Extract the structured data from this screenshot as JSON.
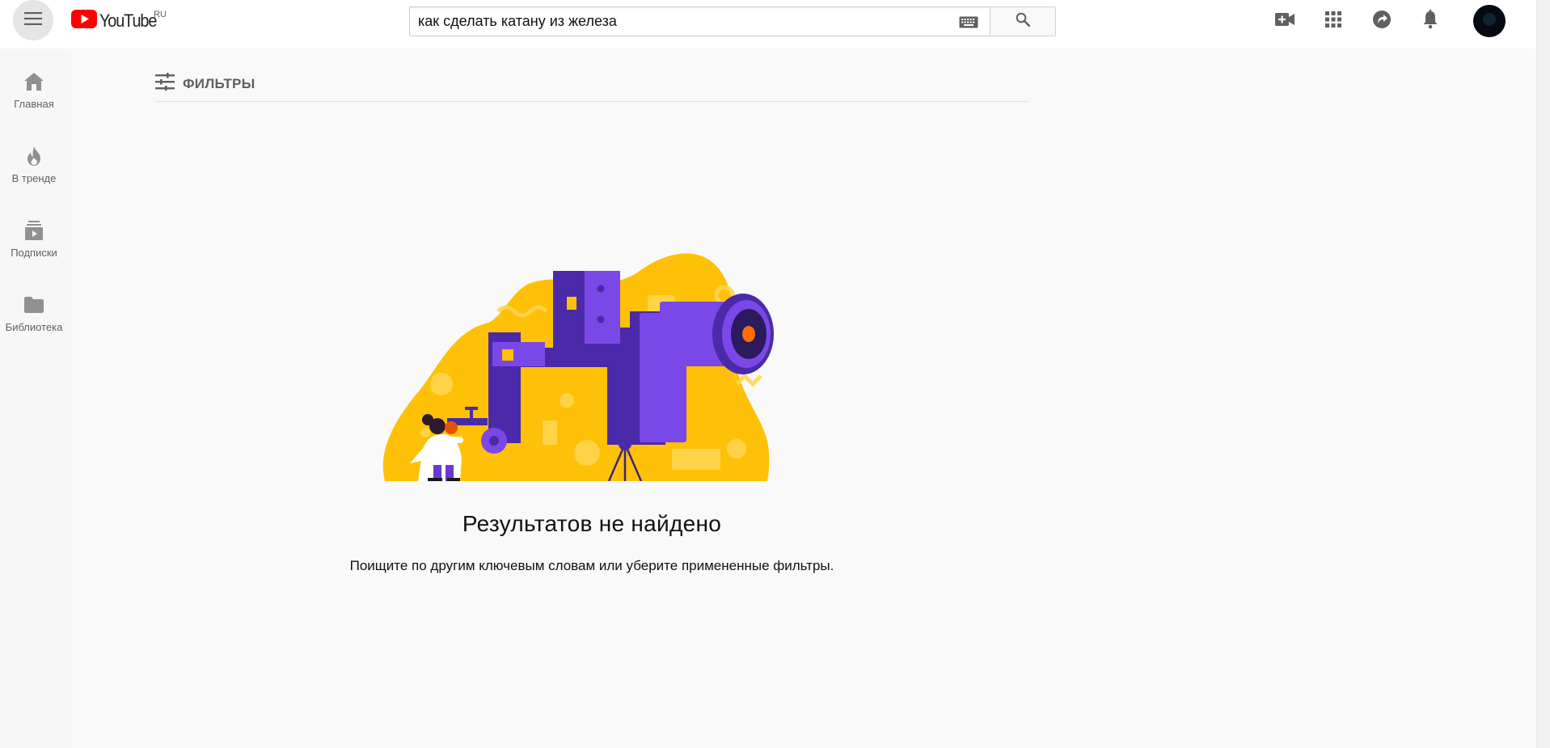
{
  "app": {
    "logo_text": "YouTube",
    "region": "RU"
  },
  "search": {
    "query": "как сделать катану из железа"
  },
  "guide": {
    "items": [
      {
        "label": "Главная"
      },
      {
        "label": "В тренде"
      },
      {
        "label": "Подписки"
      },
      {
        "label": "Библиотека"
      }
    ]
  },
  "filters": {
    "label": "ФИЛЬТРЫ"
  },
  "empty_state": {
    "title": "Результатов не найдено",
    "subtitle": "Поищите по другим ключевым словам или уберите примененные фильтры."
  },
  "colors": {
    "brand_red": "#ff0000",
    "illustration_yellow": "#ffc107",
    "illustration_purple": "#6b35d8"
  },
  "icons": {
    "menu": "hamburger-icon",
    "keyboard": "keyboard-icon",
    "search": "search-icon",
    "create": "video-camera-plus-icon",
    "apps": "apps-grid-icon",
    "messages": "share-arrow-icon",
    "notifications": "bell-icon",
    "filters": "sliders-icon"
  }
}
